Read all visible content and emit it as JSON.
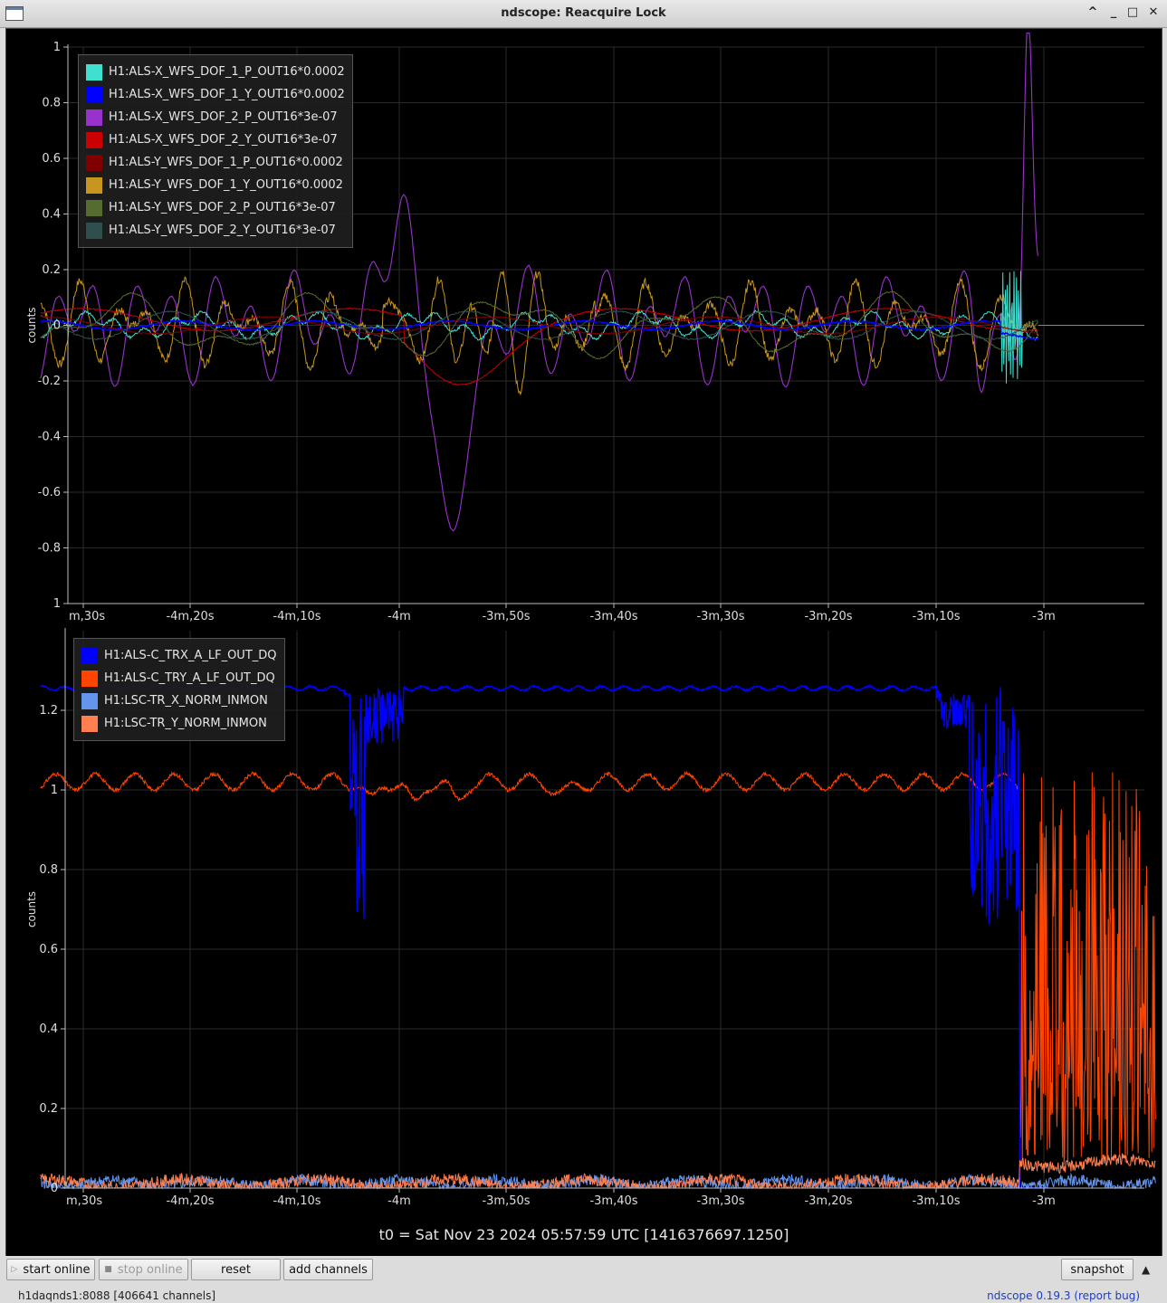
{
  "window": {
    "title": "ndscope: Reacquire Lock"
  },
  "top_plot": {
    "ylabel": "counts",
    "yticks": [
      "1",
      "0.8",
      "0.6",
      "0.4",
      "0.2",
      "0",
      "-0.2",
      "-0.4",
      "-0.6",
      "-0.8",
      "1"
    ],
    "xticks": [
      "m,30s",
      "-4m,20s",
      "-4m,10s",
      "-4m",
      "-3m,50s",
      "-3m,40s",
      "-3m,30s",
      "-3m,20s",
      "-3m,10s",
      "-3m"
    ],
    "legend": [
      {
        "label": "H1:ALS-X_WFS_DOF_1_P_OUT16*0.0002",
        "color": "#40e0d0"
      },
      {
        "label": "H1:ALS-X_WFS_DOF_1_Y_OUT16*0.0002",
        "color": "#0000ff"
      },
      {
        "label": "H1:ALS-X_WFS_DOF_2_P_OUT16*3e-07",
        "color": "#9932cc"
      },
      {
        "label": "H1:ALS-X_WFS_DOF_2_Y_OUT16*3e-07",
        "color": "#cc0000"
      },
      {
        "label": "H1:ALS-Y_WFS_DOF_1_P_OUT16*0.0002",
        "color": "#800000"
      },
      {
        "label": "H1:ALS-Y_WFS_DOF_1_Y_OUT16*0.0002",
        "color": "#c8961e"
      },
      {
        "label": "H1:ALS-Y_WFS_DOF_2_P_OUT16*3e-07",
        "color": "#556b2f"
      },
      {
        "label": "H1:ALS-Y_WFS_DOF_2_Y_OUT16*3e-07",
        "color": "#2f4f4f"
      }
    ]
  },
  "bottom_plot": {
    "ylabel": "counts",
    "yticks": [
      "1.2",
      "1",
      "0.8",
      "0.6",
      "0.4",
      "0.2",
      "0"
    ],
    "xticks": [
      "m,30s",
      "-4m,20s",
      "-4m,10s",
      "-4m",
      "-3m,50s",
      "-3m,40s",
      "-3m,30s",
      "-3m,20s",
      "-3m,10s",
      "-3m"
    ],
    "legend": [
      {
        "label": "H1:ALS-C_TRX_A_LF_OUT_DQ",
        "color": "#0000ff"
      },
      {
        "label": "H1:ALS-C_TRY_A_LF_OUT_DQ",
        "color": "#ff4500"
      },
      {
        "label": "H1:LSC-TR_X_NORM_INMON",
        "color": "#6495ed"
      },
      {
        "label": "H1:LSC-TR_Y_NORM_INMON",
        "color": "#ff7f50"
      }
    ]
  },
  "chart_data": [
    {
      "type": "line",
      "ylabel": "counts",
      "ylim": [
        -1,
        1
      ],
      "grid": true,
      "legend_position": "top-left",
      "x_unit": "seconds relative to t0",
      "x": [
        -270,
        -260,
        -250,
        -240,
        -230,
        -220,
        -210,
        -200,
        -190,
        -180,
        -170
      ],
      "series": [
        {
          "name": "H1:ALS-X_WFS_DOF_2_P_OUT16*3e-07",
          "values": [
            0,
            0.1,
            -0.1,
            0.58,
            -0.88,
            0.1,
            0.05,
            0.2,
            0.1,
            0.05,
            1.0
          ]
        },
        {
          "name": "H1:ALS-Y_WFS_DOF_1_Y_OUT16*0.0002",
          "values": [
            -0.05,
            0.1,
            -0.05,
            0.1,
            0.15,
            0.1,
            -0.1,
            0.05,
            0.1,
            0.12,
            0
          ]
        }
      ]
    },
    {
      "type": "line",
      "ylabel": "counts",
      "ylim": [
        0,
        1.4
      ],
      "grid": true,
      "legend_position": "top-left",
      "x_unit": "seconds relative to t0",
      "x": [
        -270,
        -245,
        -242,
        -240,
        -230,
        -200,
        -175,
        -173,
        -170
      ],
      "series": [
        {
          "name": "H1:ALS-C_TRX_A_LF_OUT_DQ",
          "values": [
            1.26,
            1.25,
            0.65,
            1.25,
            1.26,
            1.26,
            1.25,
            0.6,
            0
          ]
        },
        {
          "name": "H1:ALS-C_TRY_A_LF_OUT_DQ",
          "values": [
            1.02,
            1.03,
            0.99,
            1.03,
            1.0,
            1.03,
            1.05,
            1.0,
            0.5
          ]
        },
        {
          "name": "H1:LSC-TR_X_NORM_INMON",
          "values": [
            0.01,
            0.01,
            0.01,
            0.01,
            0.02,
            0.02,
            0.02,
            0.02,
            0.01
          ]
        },
        {
          "name": "H1:LSC-TR_Y_NORM_INMON",
          "values": [
            0.01,
            0.01,
            0.01,
            0.01,
            0.01,
            0.02,
            0.03,
            0.05,
            0.06
          ]
        }
      ]
    }
  ],
  "t0": "t0 = Sat Nov 23 2024 05:57:59 UTC [1416376697.1250]",
  "toolbar": {
    "start_online": "start online",
    "stop_online": "stop online",
    "reset": "reset",
    "add_channels": "add channels",
    "snapshot": "snapshot"
  },
  "status": {
    "server": "h1daqnds1:8088  [406641 channels]",
    "version": "ndscope 0.19.3",
    "report_bug": "report bug"
  }
}
